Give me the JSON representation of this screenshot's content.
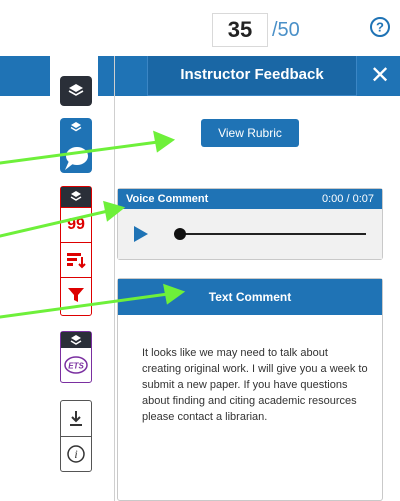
{
  "score": {
    "value": "35",
    "total": "/50"
  },
  "panel": {
    "title": "Instructor Feedback",
    "close_glyph": "✕",
    "rubric_button": "View Rubric",
    "voice_comment": {
      "label": "Voice Comment",
      "time": "0:00 / 0:07"
    },
    "text_comment": {
      "label": "Text Comment",
      "body": "It looks like we may need to talk about creating original work. I will give you a week to submit a new paper. If you have questions about finding and citing academic resources please contact a librarian."
    }
  },
  "tools": {
    "quickmark_count": "99",
    "ets_label": "ETS"
  },
  "colors": {
    "brand_blue": "#1f73b5",
    "accent_red": "#dd0000",
    "ets_purple": "#7a2fa0",
    "annotation_green": "#6ef03a"
  }
}
